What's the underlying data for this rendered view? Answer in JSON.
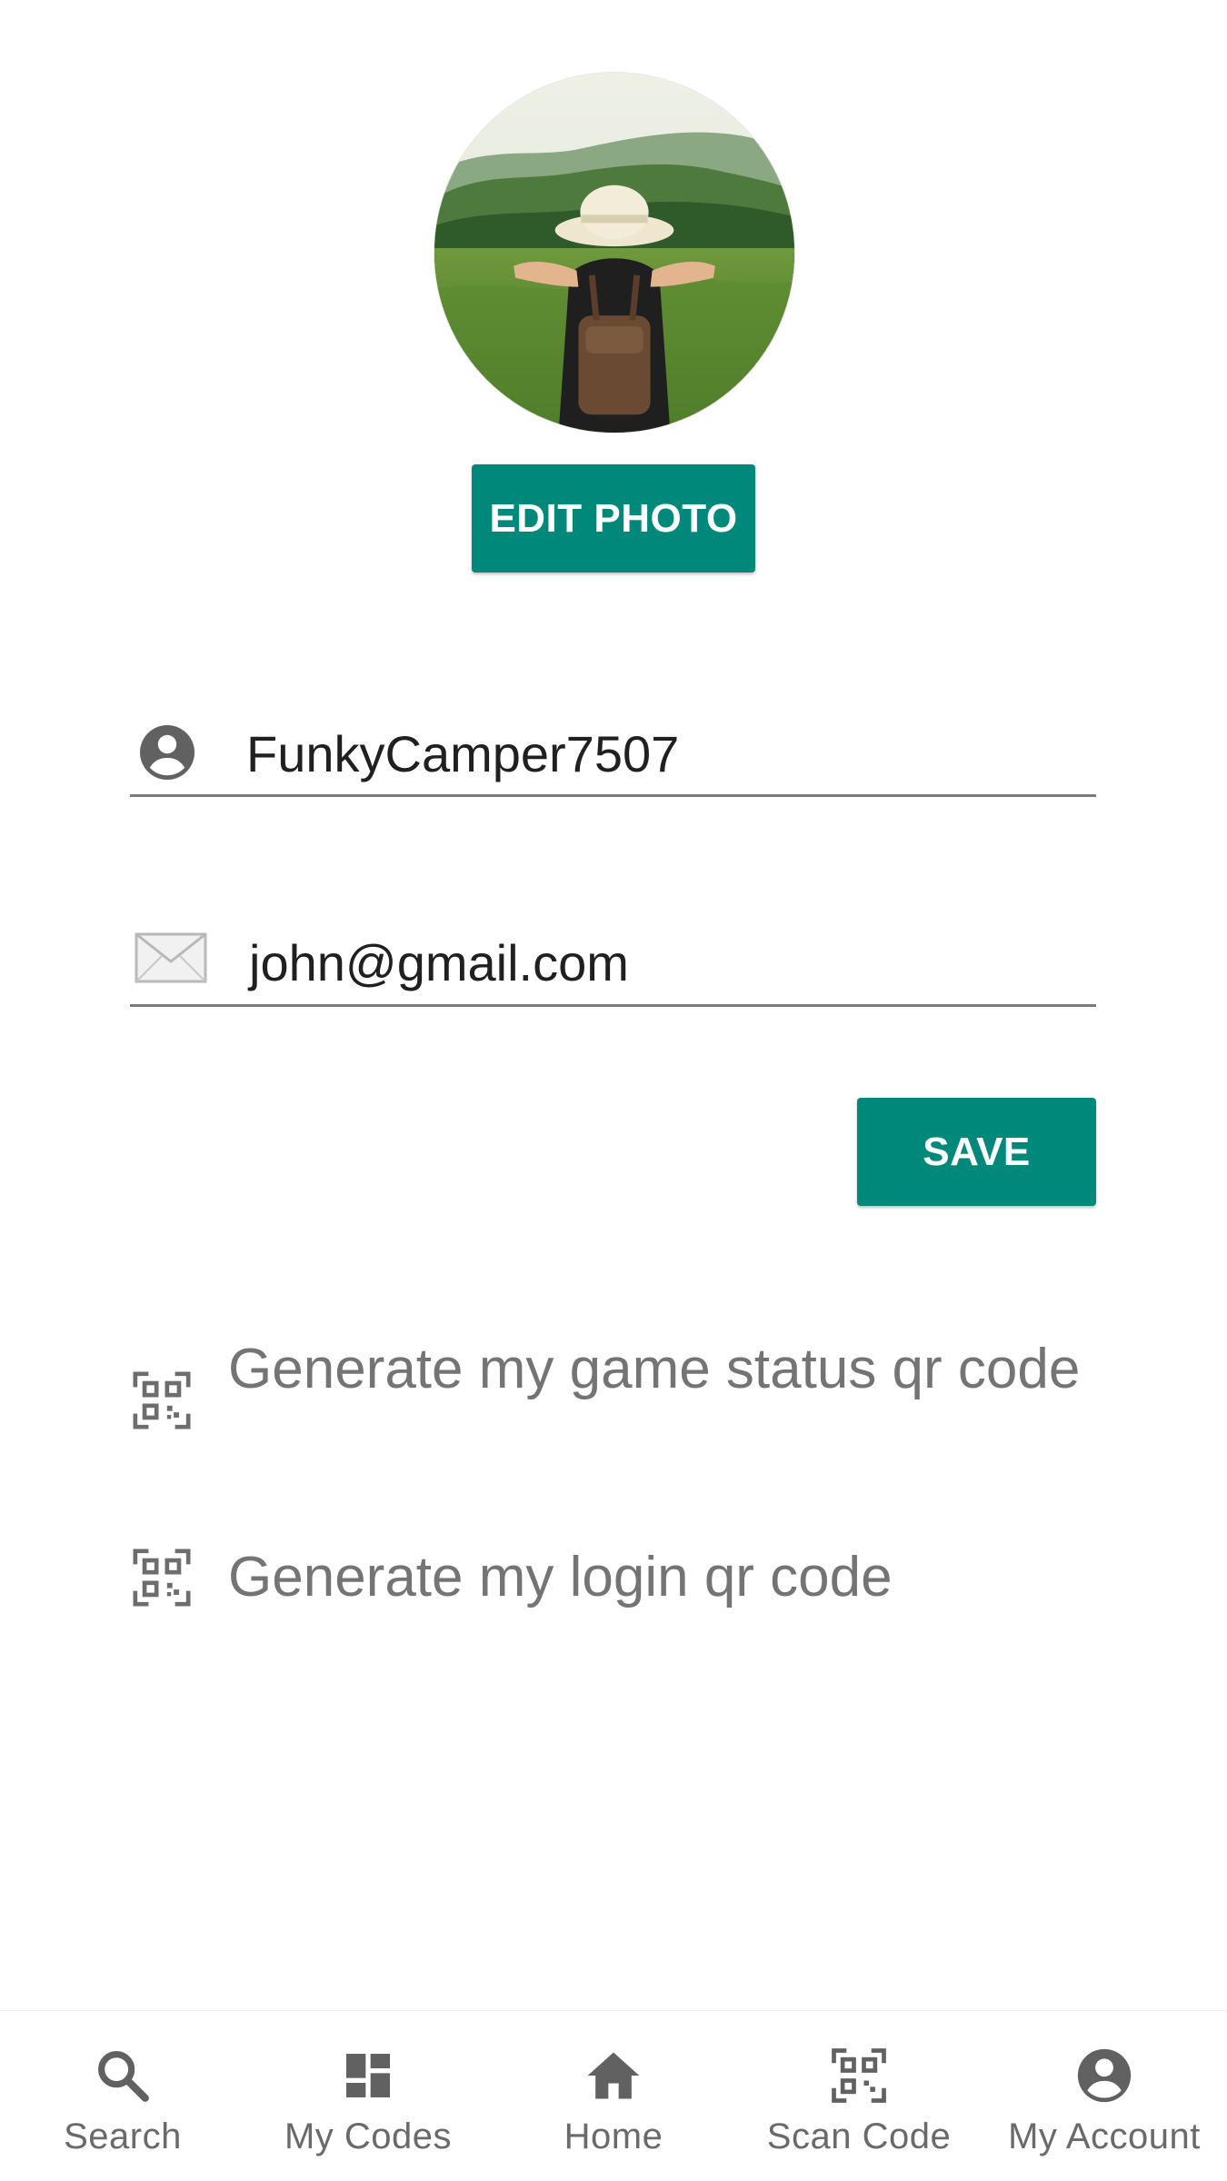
{
  "profile": {
    "edit_photo_label": "EDIT PHOTO",
    "username": "FunkyCamper7507",
    "email": "john@gmail.com",
    "save_label": "SAVE"
  },
  "actions": {
    "game_status_label": "Generate my game status qr code",
    "login_label": "Generate my login qr code"
  },
  "bottom_nav": {
    "items": [
      {
        "label": "Search",
        "icon": "search-icon"
      },
      {
        "label": "My Codes",
        "icon": "dashboard-icon"
      },
      {
        "label": "Home",
        "icon": "home-icon"
      },
      {
        "label": "Scan Code",
        "icon": "qr-scan-icon"
      },
      {
        "label": "My Account",
        "icon": "account-circle-icon"
      }
    ]
  },
  "colors": {
    "accent": "#00897b",
    "text_primary": "#202020",
    "text_secondary": "#747474",
    "icon_gray": "#616161"
  }
}
